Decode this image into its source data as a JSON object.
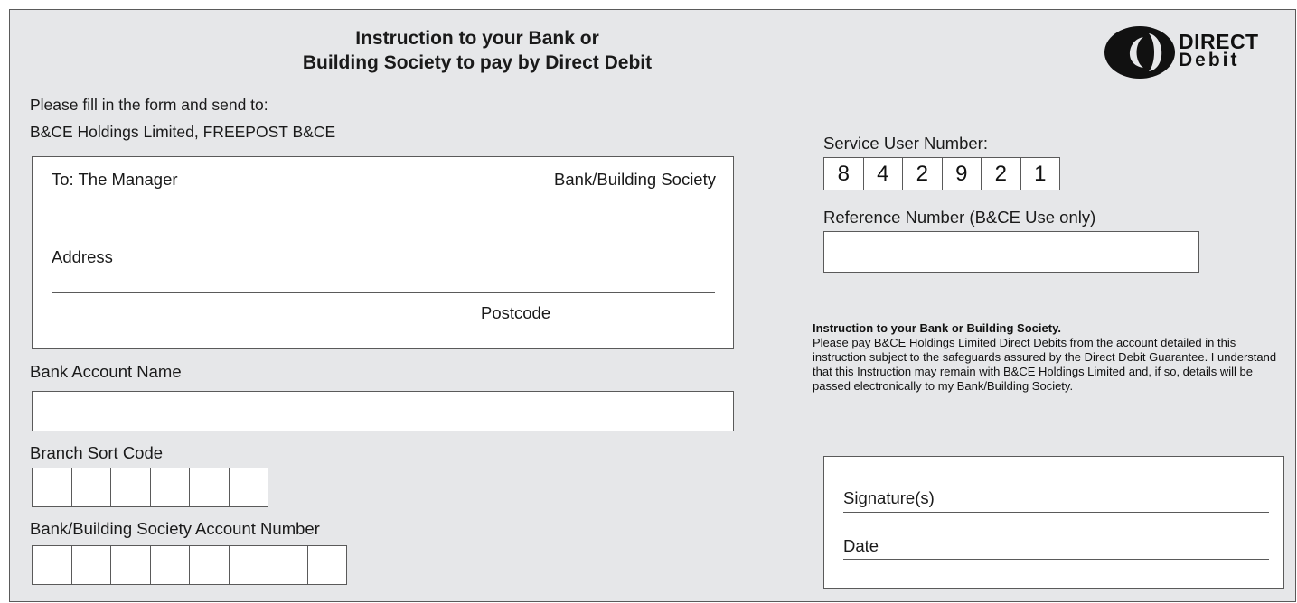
{
  "title": {
    "line1": "Instruction to your Bank or",
    "line2": "Building Society to pay by Direct Debit"
  },
  "logo": {
    "icon": "direct-debit-logo",
    "line1": "DIRECT",
    "line2": "Debit"
  },
  "send_to": {
    "line1": "Please fill in the form and send to:",
    "line2": "B&CE Holdings Limited, FREEPOST B&CE"
  },
  "bank_box": {
    "to_label": "To: The Manager",
    "bank_label": "Bank/Building Society",
    "address_label": "Address",
    "postcode_label": "Postcode"
  },
  "account_name": {
    "label": "Bank Account Name",
    "value": ""
  },
  "sort_code": {
    "label": "Branch Sort Code",
    "cells": [
      "",
      "",
      "",
      "",
      "",
      ""
    ]
  },
  "account_number": {
    "label": "Bank/Building Society Account Number",
    "cells": [
      "",
      "",
      "",
      "",
      "",
      "",
      "",
      ""
    ]
  },
  "service_user": {
    "label": "Service User Number:",
    "digits": [
      "8",
      "4",
      "2",
      "9",
      "2",
      "1"
    ]
  },
  "reference": {
    "label": "Reference Number (B&CE Use only)",
    "value": ""
  },
  "instruction": {
    "heading": "Instruction to your Bank or Building Society.",
    "body": "Please pay B&CE Holdings Limited Direct Debits from the account detailed in this instruction subject to the safeguards assured by the Direct Debit Guarantee. I understand that this Instruction may remain with B&CE Holdings Limited and, if so, details will be passed electronically to my Bank/Building Society."
  },
  "signature_box": {
    "signature_label": "Signature(s)",
    "date_label": "Date"
  },
  "colors": {
    "form_background": "#e6e7e9",
    "border": "#5a5a5a",
    "field_background": "#ffffff"
  }
}
